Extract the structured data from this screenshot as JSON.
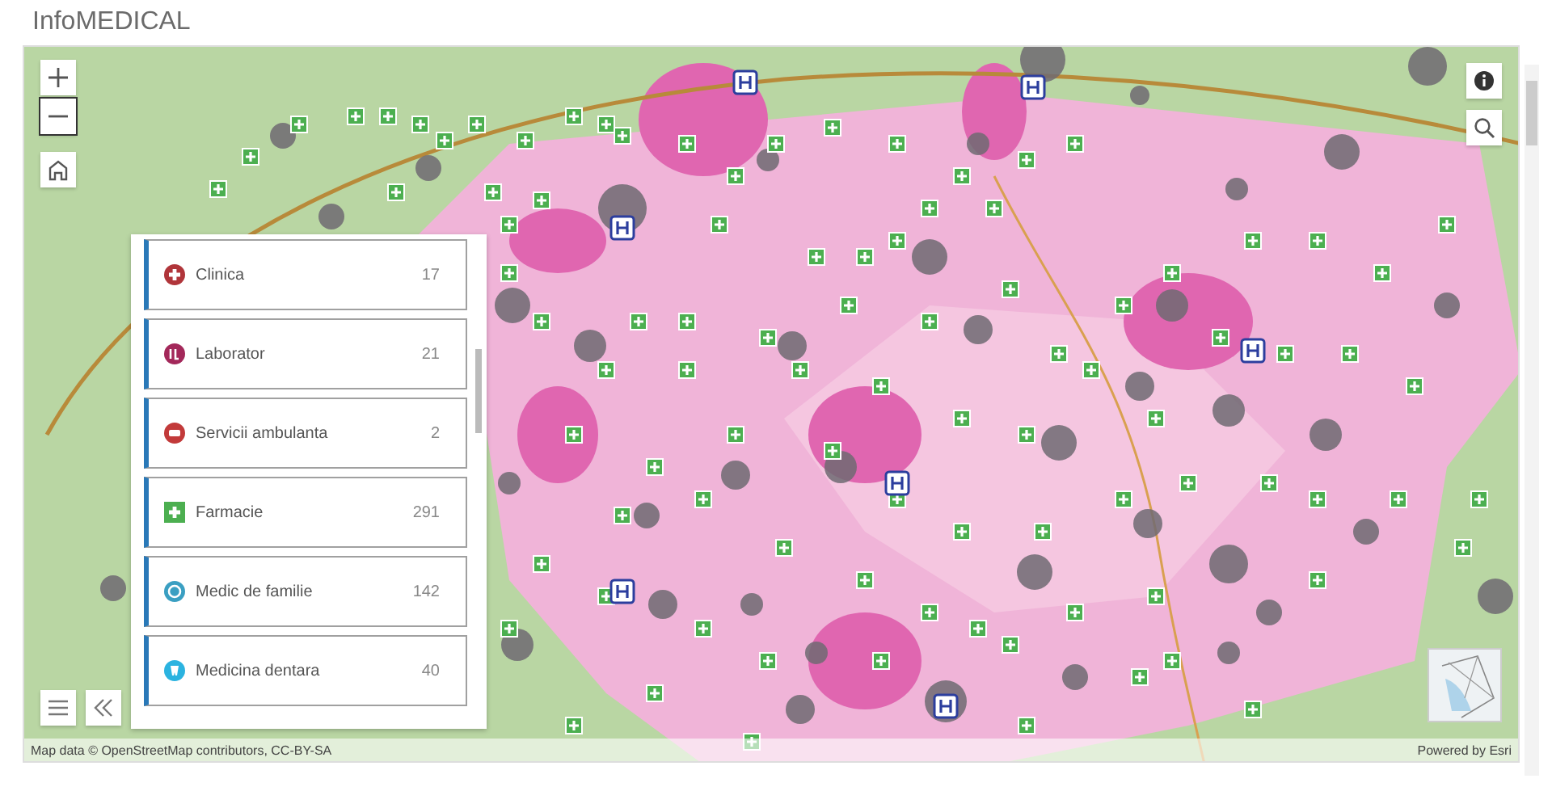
{
  "app": {
    "title": "InfoMEDICAL"
  },
  "legend": {
    "items": [
      {
        "label": "Clinica",
        "count": "17",
        "kind": "clinic",
        "color": "#b0353a"
      },
      {
        "label": "Laborator",
        "count": "21",
        "kind": "lab",
        "color": "#a3285a"
      },
      {
        "label": "Servicii ambulanta",
        "count": "2",
        "kind": "ambulance",
        "color": "#c23a3a"
      },
      {
        "label": "Farmacie",
        "count": "291",
        "kind": "pharmacy",
        "color": "#4caf50"
      },
      {
        "label": "Medic de familie",
        "count": "142",
        "kind": "family",
        "color": "#3a9fc2"
      },
      {
        "label": "Medicina dentara",
        "count": "40",
        "kind": "dental",
        "color": "#2bb3e0"
      }
    ]
  },
  "attribution": {
    "left": "Map data © OpenStreetMap contributors, CC-BY-SA",
    "right": "Powered by Esri"
  }
}
